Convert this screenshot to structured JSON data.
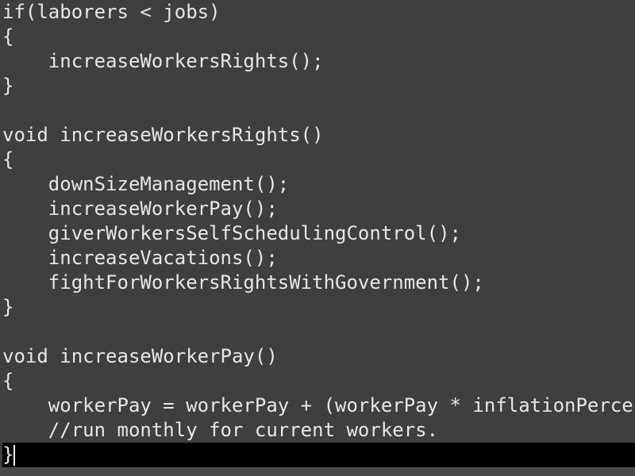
{
  "editor": {
    "lines": [
      "if(laborers < jobs)",
      "{",
      "    increaseWorkersRights();",
      "}",
      "",
      "void increaseWorkersRights()",
      "{",
      "    downSizeManagement();",
      "    increaseWorkerPay();",
      "    giverWorkersSelfSchedulingControl();",
      "    increaseVacations();",
      "    fightForWorkersRightsWithGovernment();",
      "}",
      "",
      "void increaseWorkerPay()",
      "{",
      "    workerPay = workerPay + (workerPay * inflationPerce",
      "    //run monthly for current workers.",
      "}"
    ],
    "text_color": "#e6e6e6",
    "background_color": "#3f3f3f",
    "current_line_color": "#000000"
  }
}
